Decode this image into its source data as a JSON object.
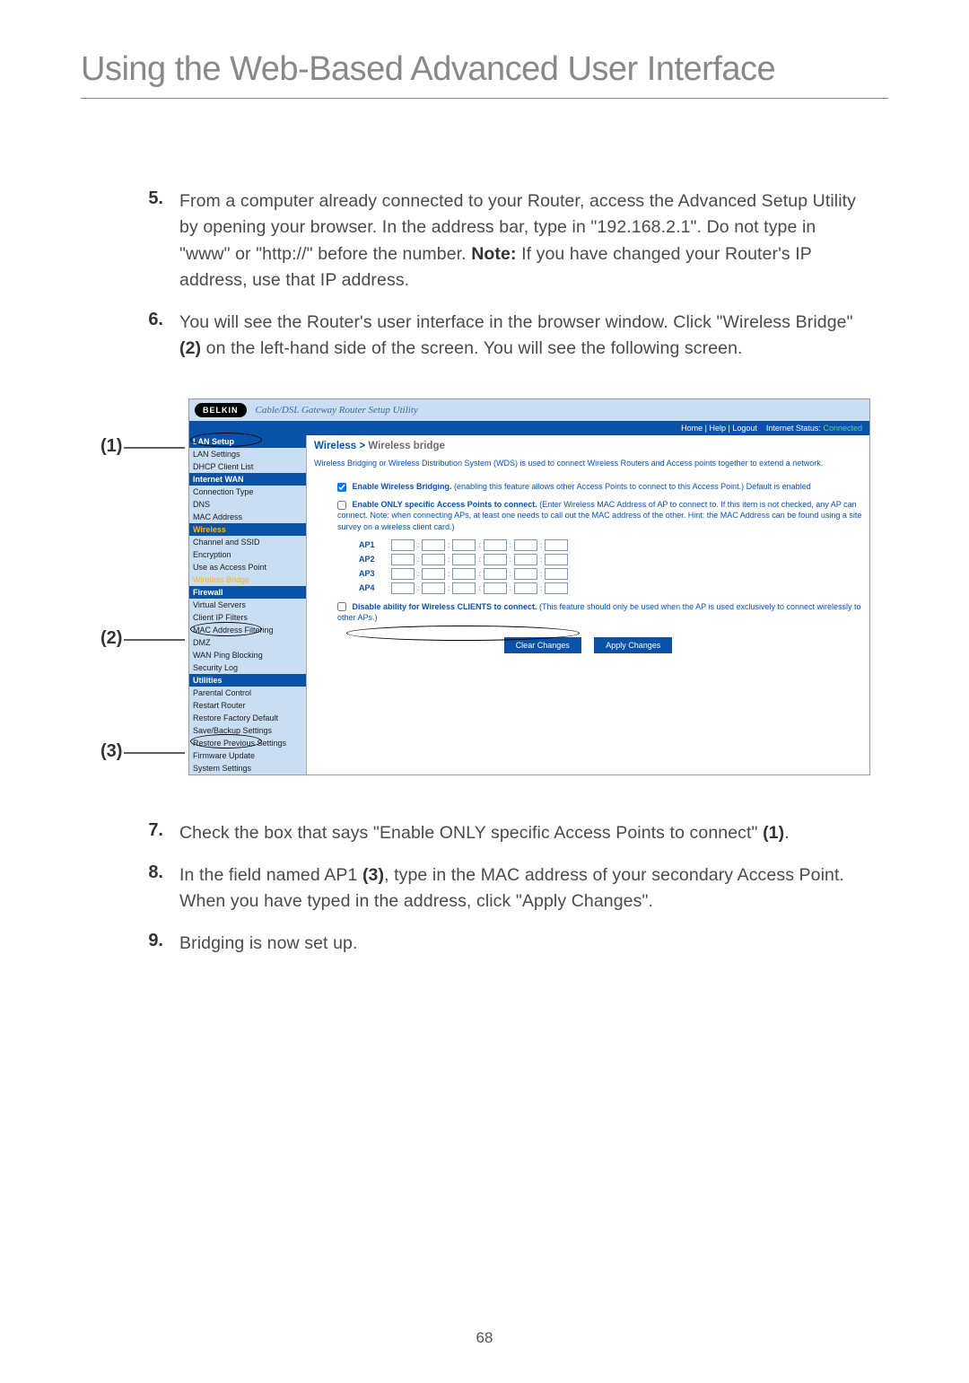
{
  "page_title": "Using the Web-Based Advanced User Interface",
  "page_number": "68",
  "steps_upper": [
    {
      "num": "5.",
      "html": "From a computer already connected to your Router, access the Advanced Setup Utility by opening your browser. In the address bar, type in \"192.168.2.1\". Do not type in \"www\" or \"http://\" before the number. <b>Note:</b> If you have changed your Router's IP address, use that IP address."
    },
    {
      "num": "6.",
      "html": "You will see the Router's user interface in the browser window. Click \"Wireless Bridge\" <b>(2)</b> on the left-hand side of the screen. You will see the following screen."
    }
  ],
  "steps_lower": [
    {
      "num": "7.",
      "html": "Check the box that says \"Enable ONLY specific Access Points to connect\" <b>(1)</b>."
    },
    {
      "num": "8.",
      "html": "In the field named AP1 <b>(3)</b>, type in the MAC address of your secondary Access Point. When you have typed in the address, click \"Apply Changes\"."
    },
    {
      "num": "9.",
      "html": "Bridging is now set up."
    }
  ],
  "callouts": {
    "c1": "(1)",
    "c2": "(2)",
    "c3": "(3)"
  },
  "router": {
    "logo": "BELKIN",
    "tagline": "Cable/DSL Gateway Router Setup Utility",
    "topbar_links": "Home | Help | Logout",
    "status_label": "Internet Status:",
    "status_value": "Connected",
    "sidebar": {
      "lan_setup": "LAN Setup",
      "lan_settings": "LAN Settings",
      "dhcp_client_list": "DHCP Client List",
      "internet_wan": "Internet WAN",
      "connection_type": "Connection Type",
      "dns": "DNS",
      "mac_address": "MAC Address",
      "wireless": "Wireless",
      "channel_ssid": "Channel and SSID",
      "encryption": "Encryption",
      "use_as_ap": "Use as Access Point",
      "wireless_bridge": "Wireless Bridge",
      "firewall": "Firewall",
      "virtual_servers": "Virtual Servers",
      "client_ip_filters": "Client IP Filters",
      "mac_addr_filtering": "MAC Address Filtering",
      "dmz": "DMZ",
      "wan_ping_blocking": "WAN Ping Blocking",
      "security_log": "Security Log",
      "utilities": "Utilities",
      "parental_control": "Parental Control",
      "restart_router": "Restart Router",
      "restore_factory": "Restore Factory Default",
      "save_backup": "Save/Backup Settings",
      "restore_prev": "Restore Previous Settings",
      "firmware_update": "Firmware Update",
      "system_settings": "System Settings"
    },
    "breadcrumb_a": "Wireless >",
    "breadcrumb_b": "Wireless bridge",
    "desc": "Wireless Bridging or Wireless Distribution System (WDS) is used to connect Wireless Routers and Access points together to extend a network.",
    "opt1_label": "Enable Wireless Bridging.",
    "opt1_text": "(enabling this feature allows other Access Points to connect to this Access Point.) Default is enabled",
    "opt2_label": "Enable ONLY specific Access Points to connect.",
    "opt2_text": "(Enter Wireless MAC Address of AP to connect to. If this item is not checked, any AP can connect. Note: when connecting APs, at least one needs to call out the MAC address of the other. Hint: the MAC Address can be found using a site survey on a wireless client card.)",
    "ap_labels": [
      "AP1",
      "AP2",
      "AP3",
      "AP4"
    ],
    "opt3_label": "Disable ability for Wireless CLIENTS to connect.",
    "opt3_text": "(This feature should only be used when the AP is used exclusively to connect wirelessly to other APs.)",
    "btn_clear": "Clear Changes",
    "btn_apply": "Apply Changes"
  }
}
